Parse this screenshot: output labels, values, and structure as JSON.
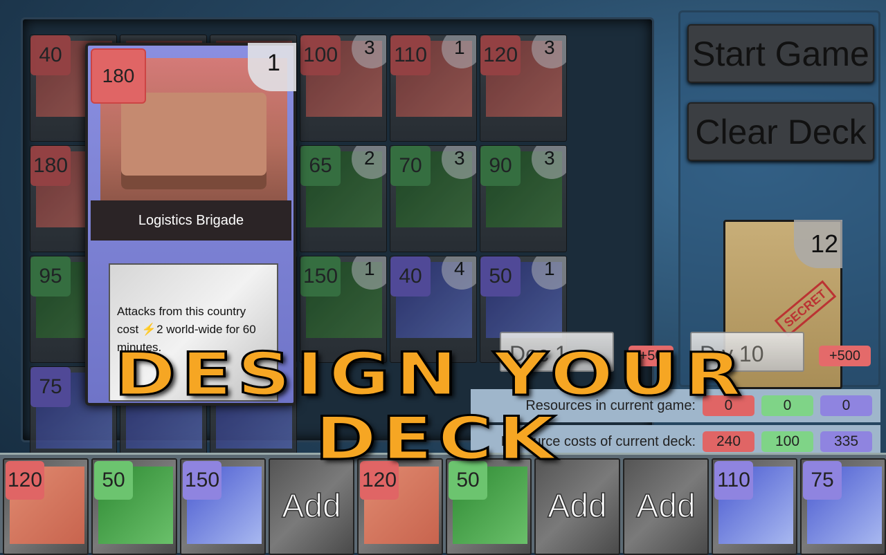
{
  "colors": {
    "red": "#e06565",
    "green": "#4fa85a",
    "purple": "#7b6fd6",
    "title": "#f6a623"
  },
  "collection": [
    {
      "cost": "40",
      "count": "",
      "color": "red"
    },
    {
      "cost": "",
      "count": "",
      "color": "red"
    },
    {
      "cost": "",
      "count": "",
      "color": "red"
    },
    {
      "cost": "100",
      "count": "3",
      "color": "red"
    },
    {
      "cost": "110",
      "count": "1",
      "color": "red"
    },
    {
      "cost": "120",
      "count": "3",
      "color": "red"
    },
    {
      "cost": "180",
      "count": "",
      "color": "red"
    },
    {
      "cost": "",
      "count": "",
      "color": "red"
    },
    {
      "cost": "",
      "count": "",
      "color": "red"
    },
    {
      "cost": "65",
      "count": "2",
      "color": "green"
    },
    {
      "cost": "70",
      "count": "3",
      "color": "green"
    },
    {
      "cost": "90",
      "count": "3",
      "color": "green"
    },
    {
      "cost": "95",
      "count": "",
      "color": "green"
    },
    {
      "cost": "",
      "count": "",
      "color": "green"
    },
    {
      "cost": "",
      "count": "",
      "color": "green"
    },
    {
      "cost": "150",
      "count": "1",
      "color": "green"
    },
    {
      "cost": "40",
      "count": "4",
      "color": "purple"
    },
    {
      "cost": "50",
      "count": "1",
      "color": "purple"
    },
    {
      "cost": "75",
      "count": "",
      "color": "purple"
    },
    {
      "cost": "",
      "count": "",
      "color": "purple"
    },
    {
      "cost": "",
      "count": "",
      "color": "purple"
    }
  ],
  "detail": {
    "cost": "180",
    "count": "1",
    "name": "Logistics Brigade",
    "text": "Attacks from this country cost ⚡2 world-wide for 60 minutes."
  },
  "buttons": {
    "start": "Start Game",
    "clear": "Clear Deck",
    "deck": "Dec    1",
    "plus50": "+50",
    "daily": "D      y 10",
    "plus500": "+500"
  },
  "deck_pile": {
    "count": "12",
    "stamp": "SECRET"
  },
  "resources": {
    "current_label": "Resources in current game:",
    "current": [
      "0",
      "0",
      "0"
    ],
    "costs_label": "Resource costs of current deck:",
    "costs": [
      "240",
      "100",
      "335"
    ]
  },
  "hand": [
    {
      "cost": "120",
      "color": "red"
    },
    {
      "cost": "50",
      "color": "green"
    },
    {
      "cost": "150",
      "color": "purple"
    },
    {
      "add": "Add"
    },
    {
      "cost": "120",
      "color": "red"
    },
    {
      "cost": "50",
      "color": "green"
    },
    {
      "add": "Add"
    },
    {
      "add": "Add"
    },
    {
      "cost": "110",
      "color": "purple"
    },
    {
      "cost": "75",
      "color": "purple"
    }
  ],
  "title": {
    "line1": "DESIGN YOUR",
    "line2": "DECK"
  }
}
